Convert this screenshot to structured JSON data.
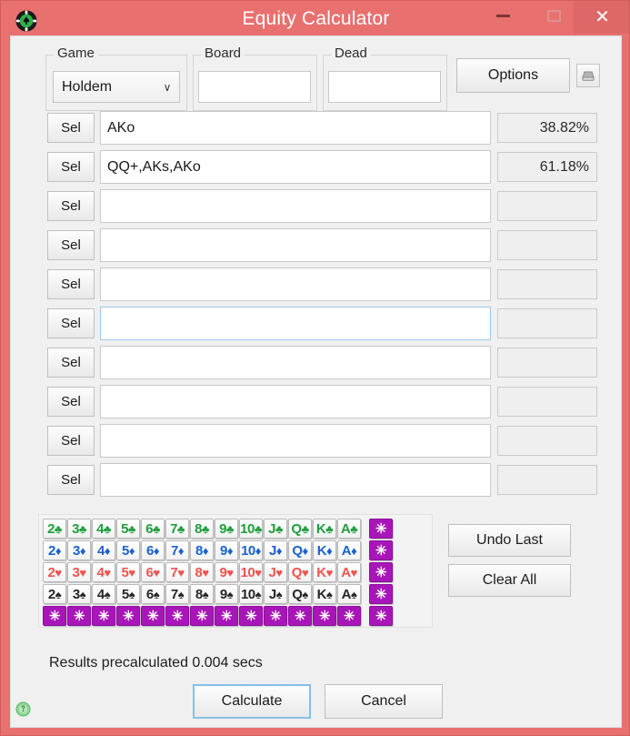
{
  "window": {
    "title": "Equity Calculator",
    "icon": "poker-chip-icon",
    "frame_color": "#e8706f",
    "controls": {
      "minimize": "—",
      "maximize": "☐",
      "close": "✕"
    }
  },
  "top": {
    "game_group_label": "Game",
    "game_value": "Holdem",
    "game_arrow": "∨",
    "board_group_label": "Board",
    "board_value": "",
    "dead_group_label": "Dead",
    "dead_value": "",
    "options_label": "Options",
    "save_icon": "save-disk-icon"
  },
  "rows": [
    {
      "sel": "Sel",
      "range": "AKo",
      "equity": "38.82%",
      "focused": false
    },
    {
      "sel": "Sel",
      "range": "QQ+,AKs,AKo",
      "equity": "61.18%",
      "focused": false
    },
    {
      "sel": "Sel",
      "range": "",
      "equity": "",
      "focused": false
    },
    {
      "sel": "Sel",
      "range": "",
      "equity": "",
      "focused": false
    },
    {
      "sel": "Sel",
      "range": "",
      "equity": "",
      "focused": false
    },
    {
      "sel": "Sel",
      "range": "",
      "equity": "",
      "focused": true
    },
    {
      "sel": "Sel",
      "range": "",
      "equity": "",
      "focused": false
    },
    {
      "sel": "Sel",
      "range": "",
      "equity": "",
      "focused": false
    },
    {
      "sel": "Sel",
      "range": "",
      "equity": "",
      "focused": false
    },
    {
      "sel": "Sel",
      "range": "",
      "equity": "",
      "focused": false
    }
  ],
  "cards": {
    "ranks": [
      "2",
      "3",
      "4",
      "5",
      "6",
      "7",
      "8",
      "9",
      "10",
      "J",
      "Q",
      "K",
      "A"
    ],
    "suits": [
      {
        "key": "c",
        "glyph": "♣",
        "color": "#1f9e3e",
        "name": "clubs"
      },
      {
        "key": "d",
        "glyph": "♦",
        "color": "#1b62cf",
        "name": "diamonds"
      },
      {
        "key": "h",
        "glyph": "♥",
        "color": "#f0534f",
        "name": "hearts"
      },
      {
        "key": "s",
        "glyph": "♠",
        "color": "#262626",
        "name": "spades"
      }
    ],
    "wildcard_glyph": "✳",
    "wildcard_color": "#a815b8"
  },
  "side": {
    "undo_label": "Undo Last",
    "clear_label": "Clear All"
  },
  "footer": {
    "status": "Results precalculated 0.004 secs",
    "calculate_label": "Calculate",
    "cancel_label": "Cancel",
    "help_icon": "green-help-icon"
  }
}
